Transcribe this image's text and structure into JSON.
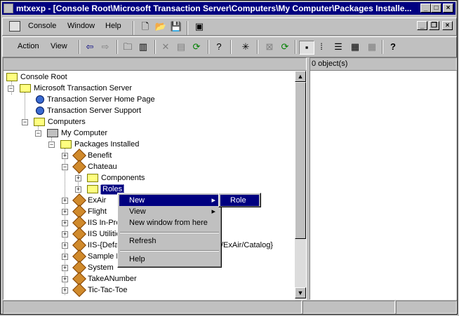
{
  "window": {
    "title": "mtxexp - [Console Root\\Microsoft Transaction Server\\Computers\\My Computer\\Packages Installe..."
  },
  "menubar": {
    "console": "Console",
    "window": "Window",
    "help": "Help"
  },
  "toolbar": {
    "action": "Action",
    "view": "View"
  },
  "right_header": "0 object(s)",
  "tree": {
    "console_root": "Console Root",
    "mts": "Microsoft Transaction Server",
    "home_page": "Transaction Server Home Page",
    "support": "Transaction Server Support",
    "computers": "Computers",
    "my_computer": "My Computer",
    "packages_installed": "Packages Installed",
    "benefit": "Benefit",
    "chateau": "Chateau",
    "components": "Components",
    "roles": "Roles",
    "exair": "ExAir",
    "flight": "Flight",
    "iis_inproc": "IIS In-Pro",
    "iis_utilities": "IIS Utilitie",
    "iis_default": "IIS-{Defa",
    "iis_default_suffix": "/ExAir/Catalog}",
    "sample": "Sample E",
    "system": "System",
    "takeanumber": "TakeANumber",
    "tictactoe": "Tic-Tac-Toe"
  },
  "context_menu": {
    "new": "New",
    "view": "View",
    "new_window": "New window from here",
    "refresh": "Refresh",
    "help": "Help"
  },
  "submenu": {
    "role": "Role"
  },
  "colors": {
    "title_bar": "#000080",
    "selection": "#000080",
    "face": "#c0c0c0"
  }
}
